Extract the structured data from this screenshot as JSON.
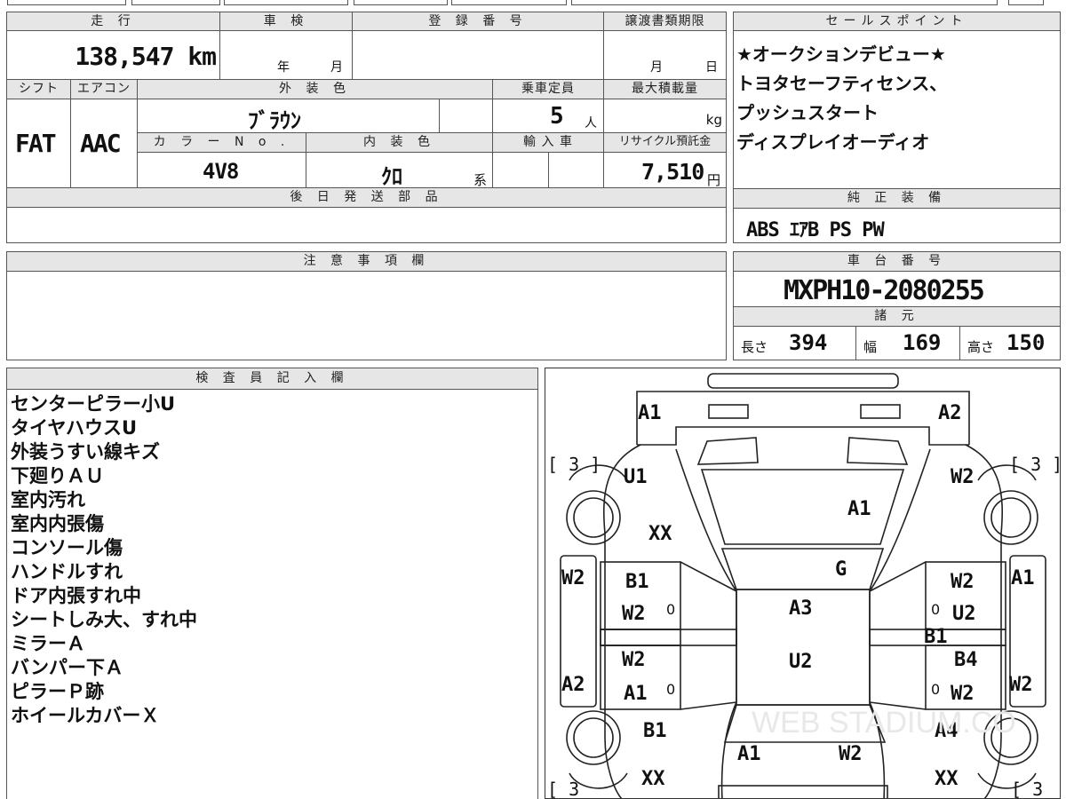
{
  "headers": {
    "mileage": "走 行",
    "inspection": "車 検",
    "registration_no": "登 録 番 号",
    "transfer_deadline": "譲渡書類期限",
    "sales_points": "セールスポイント",
    "shift": "シフト",
    "aircon": "エアコン",
    "exterior_color": "外 装 色",
    "capacity": "乗車定員",
    "max_load": "最大積載量",
    "color_no": "カ ラ ー N o .",
    "interior_color": "内 装 色",
    "import": "輸 入 車",
    "recycle": "リサイクル預託金",
    "later_parts": "後 日 発 送 部 品",
    "genuine_equipment": "純 正 装 備",
    "notes": "注 意 事 項 欄",
    "chassis_no": "車 台 番 号",
    "specs": "諸 元",
    "inspector": "検 査 員 記 入 欄"
  },
  "values": {
    "mileage": "138,547 km",
    "inspection_year_unit": "年",
    "inspection_month_unit": "月",
    "deadline_month_unit": "月",
    "deadline_day_unit": "日",
    "shift": "FAT",
    "aircon": "AAC",
    "exterior_color": "ﾌﾞﾗｳﾝ",
    "capacity": "5",
    "capacity_unit": "人",
    "max_load_unit": "kg",
    "color_no": "4V8",
    "interior_color": "ｸﾛ",
    "interior_suffix": "系",
    "recycle": "7,510",
    "recycle_unit": "円",
    "chassis_no": "MXPH10-2080255",
    "length_label": "長さ",
    "length": "394",
    "width_label": "幅",
    "width": "169",
    "height_label": "高さ",
    "height": "150"
  },
  "sales_points": [
    "★オークションデビュー★",
    "トヨタセーフティセンス、",
    "プッシュスタート",
    "ディスプレイオーディオ"
  ],
  "equipment": "ABS ｴｱB PS PW",
  "inspector_notes": [
    "センターピラー小U",
    "タイヤハウスU",
    "外装うすい線キズ",
    "下廻りＡＵ",
    "室内汚れ",
    "室内内張傷",
    "コンソール傷",
    "ハンドルすれ",
    "ドア内張すれ中",
    "シートしみ大、すれ中",
    "ミラーＡ",
    "バンパー下Ａ",
    "ピラーＰ跡",
    "ホイールカバーＸ"
  ],
  "diagram": {
    "tire_fl": "[ 3 ]",
    "tire_fr": "[ 3 ]",
    "tire_rl": "[ 3",
    "tire_rr": "[ 3",
    "front_left_corner": "A1",
    "front_right_corner": "A2",
    "hood": "A1",
    "windshield": "G",
    "roof": "A3",
    "roof_rear": "U2",
    "trunk_left": "A1",
    "trunk_right": "W2",
    "left_fender": "U1",
    "left_fender_x": "XX",
    "left_front_door_side": "W2",
    "left_front_door_b": "B1",
    "left_front_door_w": "W2",
    "left_rear_door_w": "W2",
    "left_rear_door_a": "A1",
    "left_rear_side": "A2",
    "left_rear_fender": "B1",
    "left_rear_x": "XX",
    "right_fender": "W2",
    "right_front_door_side": "A1",
    "right_front_door_w": "W2",
    "right_front_door_u": "U2",
    "right_pillar": "B1",
    "right_rear_door_b": "B4",
    "right_rear_door_w": "W2",
    "right_rear_side": "W2",
    "right_rear_fender": "A4",
    "right_rear_x": "XX",
    "zero_l1": "0",
    "zero_l2": "0",
    "zero_r1": "0",
    "zero_r2": "0",
    "watermark": "WEB STADIUM.CO"
  }
}
